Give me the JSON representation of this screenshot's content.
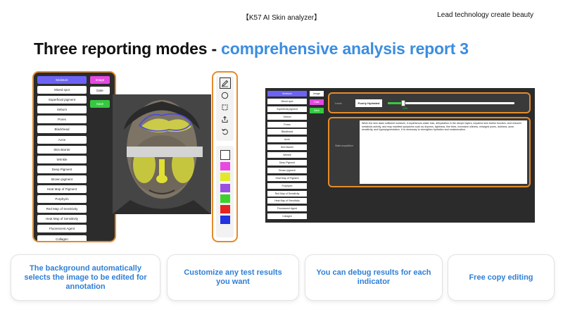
{
  "header": {
    "product_title": "【K57  AI  Skin analyzer】",
    "slogan": "Lead technology create beauty"
  },
  "headline": {
    "prefix": "Three reporting modes - ",
    "accent": "comprehensive analysis report 3"
  },
  "indicators": [
    "Moisture",
    "Mixed spot",
    "Superficial pigment",
    "Sebum",
    "Pores",
    "Blackhead",
    "Acne",
    "Skin Barrier",
    "Wrinkle",
    "Deep Pigment",
    "Brown pigment",
    "Heat Map of Pigment",
    "Porphyrin",
    "Red Map of Sensitivity",
    "Heat Map of Sensitivity",
    "Fluorescent Agent",
    "Collagen"
  ],
  "mode_buttons": {
    "image": "Image",
    "date": "Date",
    "save": "Save"
  },
  "tools": [
    "pen-icon",
    "circle-icon",
    "rectangle-icon",
    "export-icon",
    "undo-icon"
  ],
  "palette": [
    "#ffffff",
    "#e84ae0",
    "#e3e82a",
    "#9b4fe0",
    "#3ed12e",
    "#e82222",
    "#2233e0"
  ],
  "report": {
    "level_label": "Level",
    "level_value": "Poorly Hydrated",
    "level_fraction": 0.12,
    "level_percent": "12%",
    "suggestion_label": "State acquisition",
    "suggestion_text": "When the skin lacks sufficient moisture, it experiences water loss, dehydration in the deeper layers, impaired skin barrier function, and reduced metabolic activity, and may manifest symptoms such as dryness, tightness, fine lines, excessive oiliness, enlarged pores, dullness, acne, sensitivity, and hyperpigmentation. It is necessary to strengthen hydration and moisturization."
  },
  "features": [
    "The background automatically selects the image to be edited for annotation",
    "Customize any test results you want",
    "You can debug results for each indicator",
    "Free copy editing"
  ]
}
